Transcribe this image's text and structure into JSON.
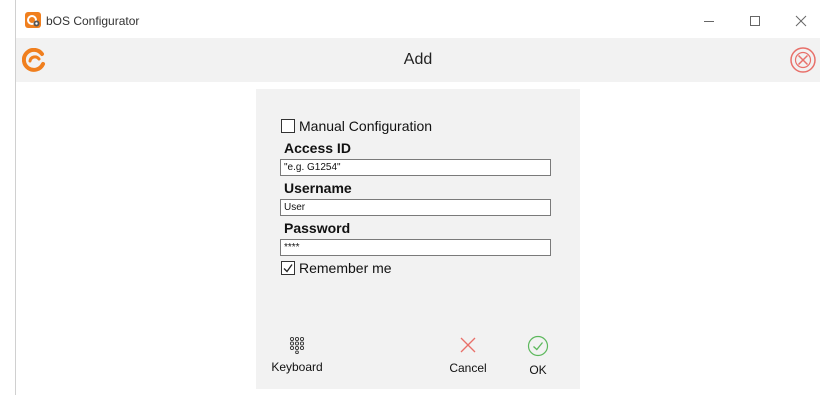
{
  "window": {
    "title": "bOS Configurator"
  },
  "header": {
    "title": "Add"
  },
  "form": {
    "manual_config_label": "Manual Configuration",
    "manual_config_checked": false,
    "access_id": {
      "label": "Access ID",
      "value": "\"e.g. G1254\""
    },
    "username": {
      "label": "Username",
      "value": "User"
    },
    "password": {
      "label": "Password",
      "value": "****"
    },
    "remember_label": "Remember me",
    "remember_checked": true
  },
  "actions": {
    "keyboard_label": "Keyboard",
    "cancel_label": "Cancel",
    "ok_label": "OK"
  },
  "colors": {
    "brand": "#f07f1e",
    "cancel": "#e8706a",
    "ok": "#5cb85c",
    "header_close": "#e8706a"
  },
  "icons": {
    "app": "gear-app-icon",
    "brand": "brand-logo-icon",
    "header_close": "close-circle-icon",
    "keyboard": "keypad-icon",
    "cancel": "cross-icon",
    "ok": "check-circle-icon"
  }
}
